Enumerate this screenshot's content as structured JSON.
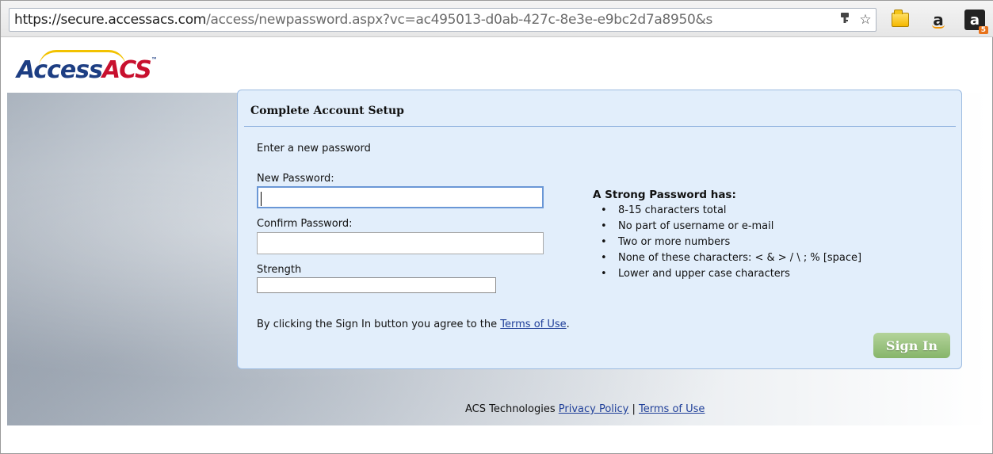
{
  "browser": {
    "url_host": "https://secure.accessacs.com",
    "url_path": "/access/newpassword.aspx?vc=ac495013-d0ab-427c-8e3e-e9bc2d7a8950&s",
    "key_icon": "key-icon",
    "star_icon": "star-icon",
    "extensions": [
      {
        "icon": "folder-icon"
      },
      {
        "icon": "amazon-icon",
        "text": "a"
      },
      {
        "icon": "amazon-assistant-icon",
        "text": "a",
        "badge": "5"
      }
    ]
  },
  "logo": {
    "part1": "Access",
    "part2": "ACS",
    "tm": "™"
  },
  "card": {
    "title": "Complete Account Setup",
    "intro": "Enter a new password",
    "new_password_label": "New Password:",
    "new_password_value": "",
    "confirm_password_label": "Confirm Password:",
    "confirm_password_value": "",
    "strength_label": "Strength",
    "rules_title": "A Strong Password has:",
    "rules": [
      "8-15 characters total",
      "No part of username or e-mail",
      "Two or more numbers",
      "None of these characters: < & > / \\ ; % [space]",
      "Lower and upper case characters"
    ],
    "agree_text": "By clicking the Sign In button you agree to the ",
    "terms_link": "Terms of Use",
    "agree_end": ".",
    "signin_label": "Sign In"
  },
  "footer": {
    "company": "ACS Technologies ",
    "privacy_link": "Privacy Policy",
    "separator": " | ",
    "terms_link": "Terms of Use"
  },
  "colors": {
    "logo_blue": "#1d3e83",
    "logo_red": "#c8102e",
    "card_bg": "#e2eefb",
    "card_border": "#9dbbe0",
    "signin_green": "#97c27a",
    "link_blue": "#1f3f99"
  }
}
